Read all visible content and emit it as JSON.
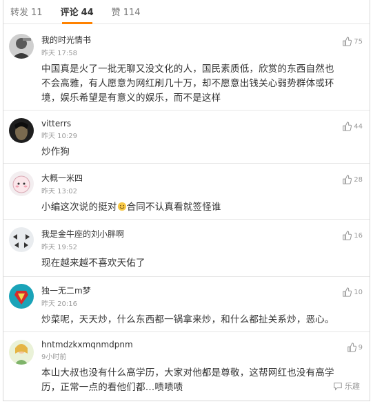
{
  "tabs": [
    {
      "label": "转发",
      "count": "11"
    },
    {
      "label": "评论",
      "count": "44"
    },
    {
      "label": "赞",
      "count": "114"
    }
  ],
  "comments": [
    {
      "user": "我的时光情书",
      "time": "昨天 17:58",
      "likes": "75",
      "text": "中国真是火了一批无聊又没文化的人，国民素质低，欣赏的东西自然也不会高雅，有人愿意为网红刷几十万，却不愿意出钱关心弱势群体或环境，娱乐希望是有意义的娱乐，而不是这样"
    },
    {
      "user": "vitterrs",
      "time": "昨天 10:29",
      "likes": "44",
      "text": "炒作狗"
    },
    {
      "user": "大概一米四",
      "time": "昨天 13:02",
      "likes": "28",
      "text_a": "小编这次说的挺对",
      "text_b": "合同不认真看就签怪谁"
    },
    {
      "user": "我是金牛座的刘小胖啊",
      "time": "昨天 19:52",
      "likes": "16",
      "text": "现在越来越不喜欢天佑了"
    },
    {
      "user": "独一无二m梦",
      "time": "昨天 20:16",
      "likes": "10",
      "text": "炒菜呢，天天炒，什么东西都一锅拿来炒，和什么都扯关系炒，恶心。"
    },
    {
      "user": "hntmdzkxmqnmdpnm",
      "time": "9小时前",
      "likes": "9",
      "text": "本山大叔也没有什么高学历，大家对他都是尊敬，这帮网红也没有高学历，正常一点的看他们都…啧啧啧"
    }
  ],
  "watermark": "乐趣",
  "icons": {
    "like": "thumbs-up-icon"
  },
  "colors": {
    "accent": "#ff8200",
    "text": "#333333",
    "muted": "#999999"
  }
}
